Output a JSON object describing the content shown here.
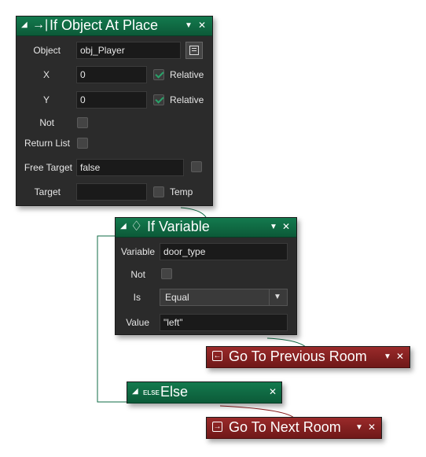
{
  "panel_if_object": {
    "title": "If Object At Place",
    "rows": {
      "object": {
        "label": "Object",
        "value": "obj_Player"
      },
      "x": {
        "label": "X",
        "value": "0",
        "relative_label": "Relative"
      },
      "y": {
        "label": "Y",
        "value": "0",
        "relative_label": "Relative"
      },
      "not": {
        "label": "Not"
      },
      "return_list": {
        "label": "Return List"
      },
      "free_target": {
        "label": "Free Target",
        "value": "false"
      },
      "target": {
        "label": "Target",
        "value": "",
        "temp_label": "Temp"
      }
    }
  },
  "panel_if_variable": {
    "title": "If Variable",
    "rows": {
      "variable": {
        "label": "Variable",
        "value": "door_type"
      },
      "not": {
        "label": "Not"
      },
      "is": {
        "label": "Is",
        "value": "Equal"
      },
      "value": {
        "label": "Value",
        "value": "\"left\""
      }
    }
  },
  "panel_else": {
    "title": "Else",
    "icon_text": "ELSE"
  },
  "action_prev_room": {
    "title": "Go To Previous Room"
  },
  "action_next_room": {
    "title": "Go To Next Room"
  },
  "colors": {
    "header_green": "#0f6b44",
    "header_red": "#7e1f1f",
    "panel_bg": "#2b2b2b",
    "check_green": "#29a36a"
  }
}
